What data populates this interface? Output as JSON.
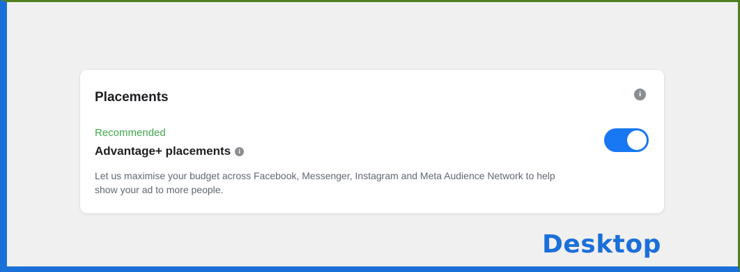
{
  "placements": {
    "title": "Placements",
    "info_icon": "info-icon",
    "option": {
      "recommended_label": "Recommended",
      "title": "Advantage+ placements",
      "description": "Let us maximise your budget across Facebook, Messenger, Instagram and Meta Audience Network to help show your ad to more people.",
      "toggle_state": "on"
    }
  },
  "watermark": {
    "text": "Desktop"
  },
  "colors": {
    "accent": "#1877f2",
    "recommended": "#3fa84b",
    "watermark": "#1b6fd9",
    "frame_green": "#4f7e1f"
  }
}
